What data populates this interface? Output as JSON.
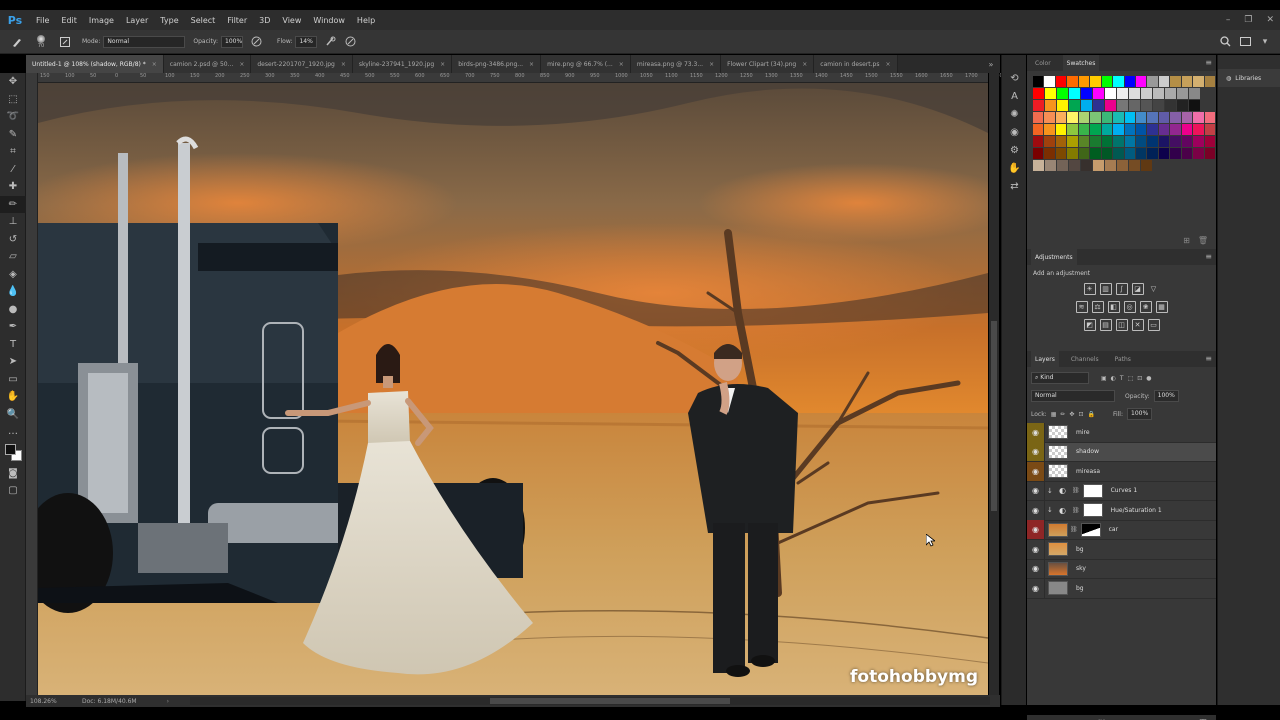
{
  "app": {
    "logo": "Ps"
  },
  "menu": [
    "File",
    "Edit",
    "Image",
    "Layer",
    "Type",
    "Select",
    "Filter",
    "3D",
    "View",
    "Window",
    "Help"
  ],
  "window_controls": [
    "–",
    "❐",
    "✕"
  ],
  "options": {
    "mode_label": "Mode:",
    "mode_value": "Normal",
    "opacity_label": "Opacity:",
    "opacity_value": "100%",
    "flow_label": "Flow:",
    "flow_value": "14%",
    "brush_size": "70"
  },
  "tabs": [
    {
      "label": "Untitled-1 @ 108% (shadow, RGB/8) *",
      "active": true
    },
    {
      "label": "camion 2.psd @ 50...",
      "active": false
    },
    {
      "label": "desert-2201707_1920.jpg",
      "active": false
    },
    {
      "label": "skyline-237941_1920.jpg",
      "active": false
    },
    {
      "label": "birds-png-3486.png...",
      "active": false
    },
    {
      "label": "mire.png @ 66.7% (...",
      "active": false
    },
    {
      "label": "mireasa.png @ 73.3...",
      "active": false
    },
    {
      "label": "Flower Clipart (34).png",
      "active": false
    },
    {
      "label": "camion in desert.ps",
      "active": false
    }
  ],
  "ruler_ticks": [
    "150",
    "100",
    "50",
    "0",
    "50",
    "100",
    "150",
    "200",
    "250",
    "300",
    "350",
    "400",
    "450",
    "500",
    "550",
    "600",
    "650",
    "700",
    "750",
    "800",
    "850",
    "900",
    "950",
    "1000",
    "1050",
    "1100",
    "1150",
    "1200",
    "1250",
    "1300",
    "1350",
    "1400",
    "1450",
    "1500",
    "1550",
    "1600",
    "1650",
    "1700",
    "1750"
  ],
  "status": {
    "zoom": "108.26%",
    "doc": "Doc: 6.18M/40.6M"
  },
  "watermark": "fotohobbymg",
  "panels": {
    "color_tabs": [
      "Color",
      "Swatches"
    ],
    "adjustments_title": "Adjustments",
    "add_adjustment": "Add an adjustment",
    "layers_tabs": [
      "Layers",
      "Channels",
      "Paths"
    ],
    "filter_kind": "Kind",
    "blend_mode": "Normal",
    "opacity_label": "Opacity:",
    "opacity_value": "100%",
    "lock_label": "Lock:",
    "fill_label": "Fill:",
    "fill_value": "100%",
    "libraries": "Libraries"
  },
  "layers": [
    {
      "name": "mire",
      "eye": "gold",
      "thumb": "checker",
      "selected": false
    },
    {
      "name": "shadow",
      "eye": "gold",
      "thumb": "checker",
      "selected": true
    },
    {
      "name": "mireasa",
      "eye": "brown",
      "thumb": "checker",
      "selected": false
    },
    {
      "name": "Curves 1",
      "eye": "none",
      "thumb": "adjust",
      "selected": false
    },
    {
      "name": "Hue/Saturation 1",
      "eye": "none",
      "thumb": "adjust",
      "selected": false
    },
    {
      "name": "car",
      "eye": "red",
      "thumb": "photo",
      "selected": false
    },
    {
      "name": "bg",
      "eye": "none",
      "thumb": "desert",
      "selected": false
    },
    {
      "name": "sky",
      "eye": "none",
      "thumb": "sky",
      "selected": false
    },
    {
      "name": "bg",
      "eye": "none",
      "thumb": "gray",
      "selected": false
    }
  ],
  "swatch_colors": [
    [
      "#000000",
      "#ffffff",
      "#ff0000",
      "#ff6a00",
      "#ff9a00",
      "#ffcc00",
      "#00ff00",
      "#00ffff",
      "#0000ff",
      "#ff00ff",
      "#999999",
      "#cccccc",
      "#b58f46",
      "#c6a05a",
      "#d4b070",
      "#a58040"
    ],
    [
      "#ff0000",
      "#ffff00",
      "#00ff00",
      "#00ffff",
      "#0000ff",
      "#ff00ff",
      "#ffffff",
      "#eeeeee",
      "#dddddd",
      "#cccccc",
      "#bbbbbb",
      "#aaaaaa",
      "#999999",
      "#888888"
    ],
    [
      "#ed1c24",
      "#f7941d",
      "#fff200",
      "#00a651",
      "#00aeef",
      "#2e3192",
      "#ec008c",
      "#777777",
      "#666666",
      "#555555",
      "#444444",
      "#333333",
      "#222222",
      "#111111"
    ],
    [
      "#f26c4f",
      "#f68e55",
      "#fbaf5c",
      "#fff467",
      "#acd372",
      "#7cc576",
      "#3bb878",
      "#1abbb4",
      "#00bff3",
      "#438cca",
      "#5574b9",
      "#605ca8",
      "#855fa8",
      "#a763a8",
      "#f06ea9",
      "#f26d7d"
    ],
    [
      "#f26522",
      "#f7941d",
      "#fff200",
      "#8dc73f",
      "#39b54a",
      "#00a651",
      "#00a99d",
      "#00aeef",
      "#0072bc",
      "#0054a6",
      "#2e3192",
      "#662d91",
      "#92278f",
      "#ec008c",
      "#ed145b",
      "#c23f45"
    ],
    [
      "#9e0b0f",
      "#a0410d",
      "#a36209",
      "#aba000",
      "#598527",
      "#1a7b30",
      "#007236",
      "#00746b",
      "#0076a3",
      "#004b80",
      "#003471",
      "#1b1464",
      "#440e62",
      "#630460",
      "#9e005d",
      "#9e0039"
    ],
    [
      "#790000",
      "#7b2e00",
      "#7d4900",
      "#827b00",
      "#406618",
      "#005e20",
      "#005826",
      "#005952",
      "#005b7f",
      "#003663",
      "#002157",
      "#0d004c",
      "#32004b",
      "#4b0049",
      "#7b0046",
      "#7a0026"
    ],
    [
      "#c7b299",
      "#998675",
      "#736357",
      "#534741",
      "#37302d",
      "#c69c6d",
      "#a67c52",
      "#8c6239",
      "#754c24",
      "#603913"
    ]
  ],
  "colors": {
    "accent": "#3aa0e8",
    "panel_bg": "#383838",
    "app_bg": "#2d2d2d"
  }
}
